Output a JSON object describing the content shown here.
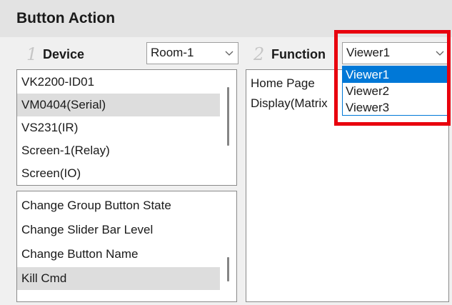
{
  "panel": {
    "title": "Button Action"
  },
  "device": {
    "step_number": "1",
    "label": "Device",
    "room_select": {
      "value": "Room-1"
    },
    "devices": [
      {
        "label": "VK2200-ID01",
        "selected": false
      },
      {
        "label": "VM0404(Serial)",
        "selected": true
      },
      {
        "label": "VS231(IR)",
        "selected": false
      },
      {
        "label": "Screen-1(Relay)",
        "selected": false
      },
      {
        "label": "Screen(IO)",
        "selected": false
      }
    ],
    "actions": [
      {
        "label": "Change Group Button State",
        "selected": false
      },
      {
        "label": "Change Slider Bar Level",
        "selected": false
      },
      {
        "label": "Change Button Name",
        "selected": false
      },
      {
        "label": "Kill Cmd",
        "selected": true
      }
    ]
  },
  "function": {
    "step_number": "2",
    "label": "Function",
    "viewer_select": {
      "value": "Viewer1",
      "options": [
        "Viewer1",
        "Viewer2",
        "Viewer3"
      ],
      "highlighted": "Viewer1",
      "expanded": true
    },
    "items": [
      {
        "label": "Home Page"
      },
      {
        "label": "Display(Matrix"
      }
    ]
  },
  "colors": {
    "title_bar": "#e3e3e3",
    "selection": "#dddddd",
    "dropdown_highlight": "#0078d7",
    "annotation_box": "#e8000d"
  }
}
